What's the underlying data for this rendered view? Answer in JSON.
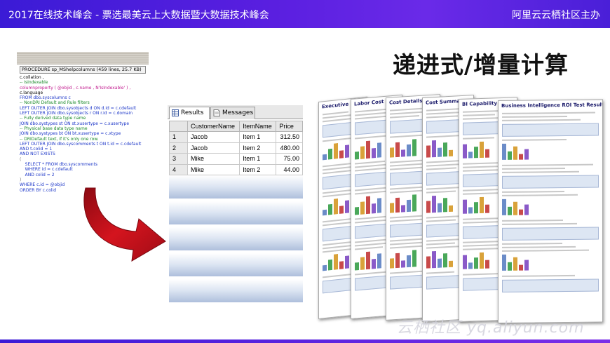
{
  "header": {
    "title": "2017在线技术峰会 - 票选最美云上大数据暨大数据技术峰会",
    "host": "阿里云云栖社区主办"
  },
  "slide_heading": "递进式/增量计算",
  "sql_window": {
    "title": "PROCEDURE sp_MShelpcolumns  (459 lines, 25.7 KB)",
    "lines": [
      {
        "t": "c.collation ,",
        "c": "tx"
      },
      {
        "t": "-- IsIndexable",
        "c": "cm"
      },
      {
        "t": "columnproperty ( @objid , c.name , N'IsIndexable' ) ,",
        "c": "fn"
      },
      {
        "t": "c.language",
        "c": "tx"
      },
      {
        "t": "FROM dbo.syscolumns c",
        "c": "kw"
      },
      {
        "t": "-- NonDRI Default and Rule filters",
        "c": "cm"
      },
      {
        "t": "LEFT OUTER JOIN dbo.sysobjects d ON d.id = c.cdefault",
        "c": "kw"
      },
      {
        "t": "LEFT OUTER JOIN dbo.sysobjects r ON r.id = c.domain",
        "c": "kw"
      },
      {
        "t": "-- Fully derived data type name",
        "c": "cm"
      },
      {
        "t": "JOIN dbo.systypes st ON st.xusertype = c.xusertype",
        "c": "kw"
      },
      {
        "t": "-- Physical base data type name",
        "c": "cm"
      },
      {
        "t": "JOIN dbo.systypes bt ON bt.xusertype = c.xtype",
        "c": "kw"
      },
      {
        "t": "-- DRIDefault text, if it's only one row.",
        "c": "cm"
      },
      {
        "t": "LEFT OUTER JOIN dbo.syscomments t ON t.id = c.cdefault",
        "c": "kw"
      },
      {
        "t": "AND t.colid = 1",
        "c": "kw"
      },
      {
        "t": "AND NOT EXISTS",
        "c": "kw"
      },
      {
        "t": "(",
        "c": "gr"
      },
      {
        "t": "    SELECT * FROM dbo.syscomments",
        "c": "kw"
      },
      {
        "t": "    WHERE id = c.cdefault",
        "c": "kw"
      },
      {
        "t": "    AND colid = 2",
        "c": "kw"
      },
      {
        "t": ")",
        "c": "gr"
      },
      {
        "t": "WHERE c.id = @objid",
        "c": "kw"
      },
      {
        "t": "ORDER BY c.colid",
        "c": "kw"
      }
    ]
  },
  "results_panel": {
    "tabs": [
      {
        "label": "Results",
        "icon": "grid-icon"
      },
      {
        "label": "Messages",
        "icon": "document-icon"
      }
    ],
    "columns": [
      "CustomerName",
      "ItemName",
      "Price"
    ],
    "rows": [
      {
        "n": "1",
        "customer": "Jacob",
        "item": "Item 1",
        "price": "312.50"
      },
      {
        "n": "2",
        "customer": "Jacob",
        "item": "Item 2",
        "price": "480.00"
      },
      {
        "n": "3",
        "customer": "Mike",
        "item": "Item 1",
        "price": "75.00"
      },
      {
        "n": "4",
        "customer": "Mike",
        "item": "Item 2",
        "price": "44.00"
      }
    ],
    "placeholder_band_count": 5
  },
  "report_sheets": [
    {
      "title": "Executive Benefit (Pre-Profi...",
      "rot": -10
    },
    {
      "title": "Labor Cost Savings",
      "rot": -8
    },
    {
      "title": "Cost Details",
      "rot": -6
    },
    {
      "title": "Cost Summary",
      "rot": -5
    },
    {
      "title": "BI Capability Adoption",
      "rot": -3
    },
    {
      "title": "Business Intelligence ROI Test Results Report",
      "rot": -1
    }
  ],
  "watermark": "云栖社区 yq.aliyun.com",
  "colors": {
    "header_start": "#3b1bd6",
    "header_end": "#6a2ae8",
    "arrow": "#c8101a"
  }
}
